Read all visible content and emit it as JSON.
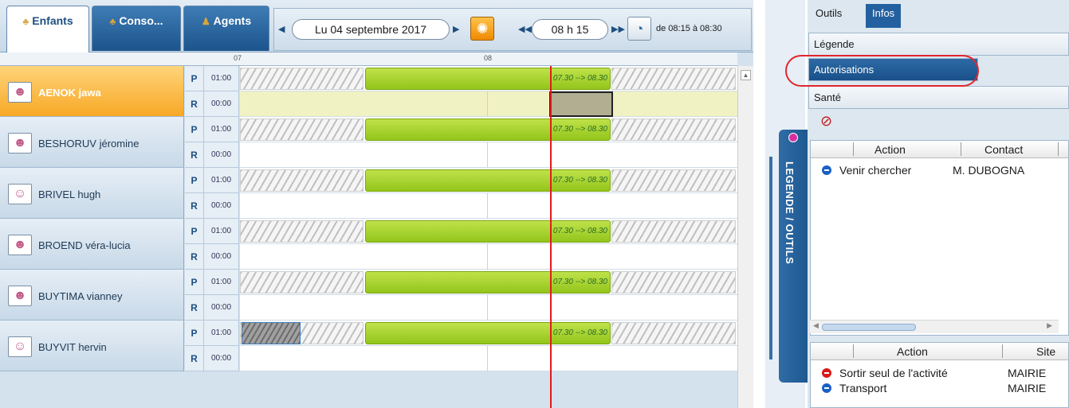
{
  "tabs": [
    {
      "label": "Enfants",
      "icon": "children-icon"
    },
    {
      "label": "Conso...",
      "icon": "consumption-icon"
    },
    {
      "label": "Agents",
      "icon": "agent-icon"
    }
  ],
  "nav": {
    "date": "Lu 04 septembre 2017",
    "time": "08 h 15",
    "range": "de 08:15 à 08:30"
  },
  "ruler": {
    "ticks": [
      "07",
      "08"
    ]
  },
  "children": [
    {
      "name": "AENOK jawa",
      "avatar": "girl-avatar-icon",
      "p": "P",
      "p_dur": "01:00",
      "r": "R",
      "r_dur": "00:00",
      "slot": "07.30 --> 08.30",
      "selected": true
    },
    {
      "name": "BESHORUV jéromine",
      "avatar": "girl-avatar-icon",
      "p": "P",
      "p_dur": "01:00",
      "r": "R",
      "r_dur": "00:00",
      "slot": "07.30 --> 08.30"
    },
    {
      "name": "BRIVEL hugh",
      "avatar": "boy-avatar-icon",
      "p": "P",
      "p_dur": "01:00",
      "r": "R",
      "r_dur": "00:00",
      "slot": "07.30 --> 08.30"
    },
    {
      "name": "BROEND véra-lucia",
      "avatar": "girl-avatar-icon",
      "p": "P",
      "p_dur": "01:00",
      "r": "R",
      "r_dur": "00:00",
      "slot": "07.30 --> 08.30"
    },
    {
      "name": "BUYTIMA vianney",
      "avatar": "girl-avatar-icon",
      "p": "P",
      "p_dur": "01:00",
      "r": "R",
      "r_dur": "00:00",
      "slot": "07.30 --> 08.30"
    },
    {
      "name": "BUYVIT hervin",
      "avatar": "boy-avatar-icon",
      "p": "P",
      "p_dur": "01:00",
      "r": "R",
      "r_dur": "00:00",
      "slot": "07.30 --> 08.30"
    }
  ],
  "side_tab": {
    "label": "LEGENDE / OUTILS"
  },
  "right": {
    "tabs": [
      "Outils",
      "Infos"
    ],
    "sections": [
      "Légende",
      "Autorisations",
      "Santé"
    ],
    "grid1": {
      "headers": [
        "Action",
        "Contact"
      ],
      "rows": [
        {
          "action": "Venir chercher",
          "contact": "M. DUBOGNA"
        }
      ]
    },
    "grid2": {
      "headers": [
        "Action",
        "Site"
      ],
      "rows": [
        {
          "action": "Sortir seul de l'activité",
          "site": "MAIRIE",
          "status": "red"
        },
        {
          "action": "Transport",
          "site": "MAIRIE",
          "status": "blue"
        }
      ]
    }
  },
  "colors": {
    "accent": "#1d5a95",
    "selected": "#f7a826",
    "slot": "#a6d22c",
    "marker": "#e31b1b"
  }
}
